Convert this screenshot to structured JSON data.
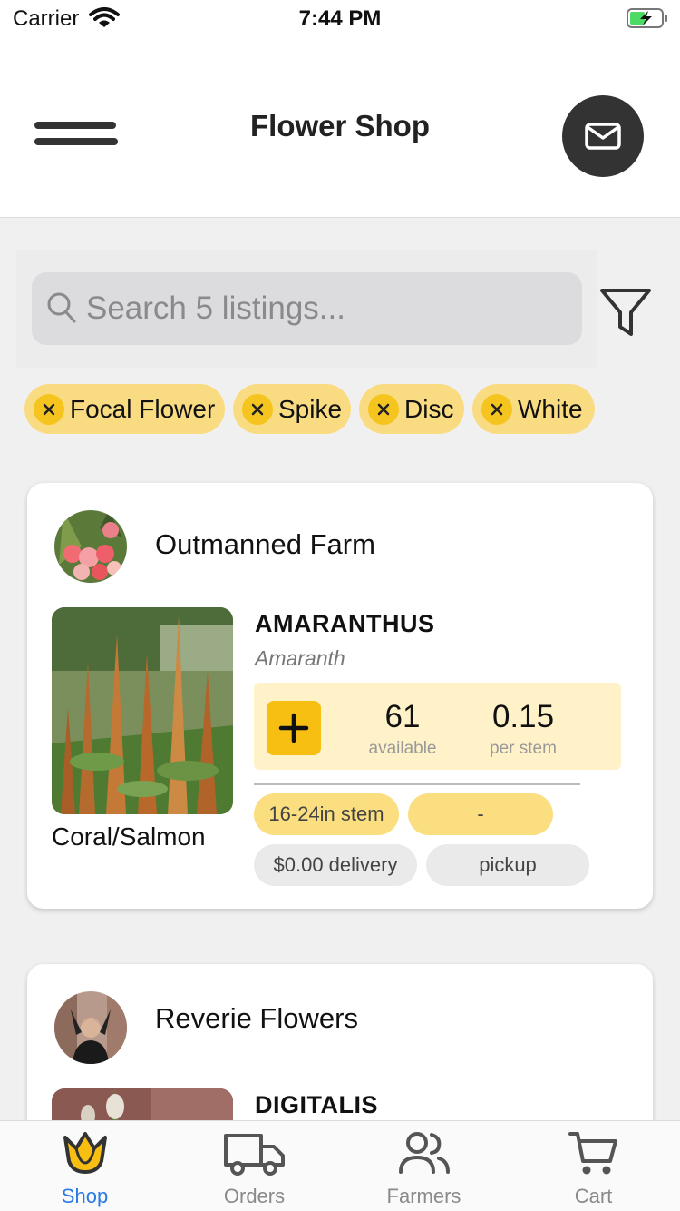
{
  "status_bar": {
    "carrier": "Carrier",
    "time": "7:44 PM"
  },
  "header": {
    "title": "Flower Shop"
  },
  "search": {
    "placeholder": "Search 5 listings..."
  },
  "filters": [
    "Focal Flower",
    "Spike",
    "Disc",
    "White"
  ],
  "listings": [
    {
      "farm": "Outmanned Farm",
      "name": "AMARANTHUS",
      "latin": "Amaranth",
      "variety": "Coral/Salmon",
      "available": "61",
      "available_label": "available",
      "price": "0.15",
      "price_label": "per stem",
      "stem_tag": "16-24in stem",
      "extra_tag": "-",
      "delivery_tag": "$0.00 delivery",
      "pickup_tag": "pickup"
    },
    {
      "farm": "Reverie Flowers",
      "name": "DIGITALIS"
    }
  ],
  "tabs": [
    {
      "label": "Shop",
      "active": true
    },
    {
      "label": "Orders",
      "active": false
    },
    {
      "label": "Farmers",
      "active": false
    },
    {
      "label": "Cart",
      "active": false
    }
  ],
  "colors": {
    "accent": "#f6bf11",
    "chip": "#f9dc82",
    "active_tab": "#2a7ae2"
  }
}
